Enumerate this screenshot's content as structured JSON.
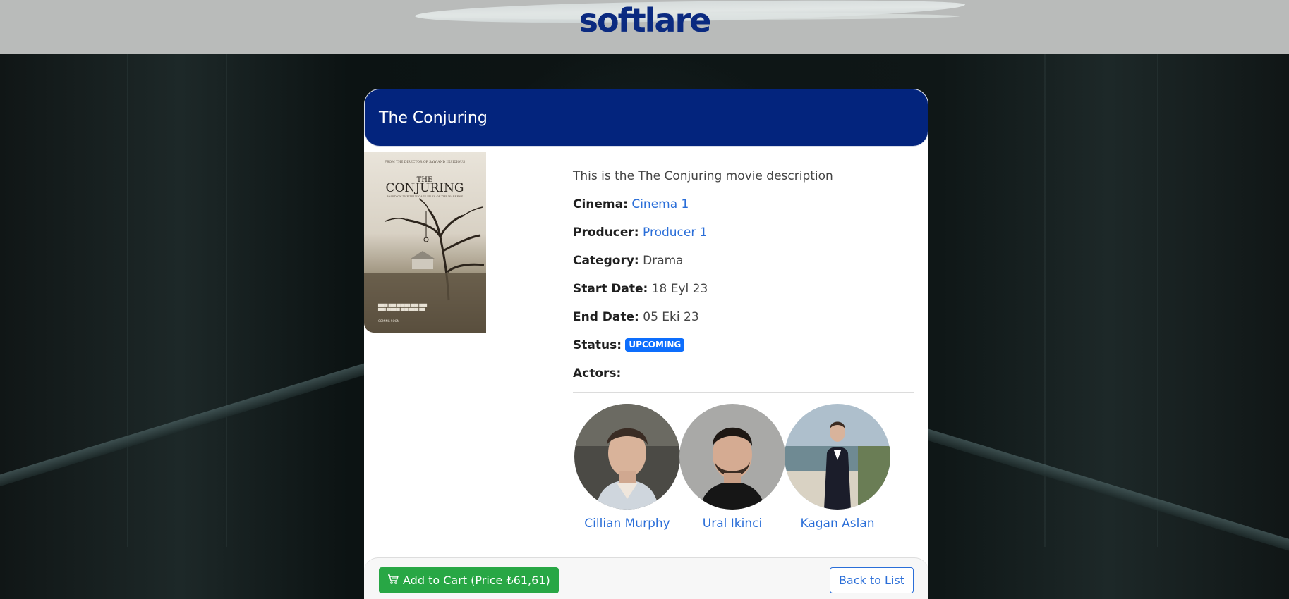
{
  "header": {
    "logo_text": "softlare"
  },
  "movie": {
    "title": "The Conjuring",
    "description": "This is the The Conjuring movie description",
    "cinema_label": "Cinema:",
    "cinema_value": "Cinema 1",
    "producer_label": "Producer:",
    "producer_value": "Producer 1",
    "category_label": "Category:",
    "category_value": "Drama",
    "start_label": "Start Date:",
    "start_value": "18 Eyl 23",
    "end_label": "End Date:",
    "end_value": "05 Eki 23",
    "status_label": "Status:",
    "status_value": "UPCOMING",
    "actors_label": "Actors:",
    "poster": {
      "top_line": "FROM THE DIRECTOR OF SAW AND INSIDIOUS",
      "title_line1": "THE",
      "title_line2": "CONJURING",
      "tagline": "BASED ON THE TRUE CASE FILES OF THE WARRENS",
      "coming_soon": "COMING SOON"
    }
  },
  "actors": [
    {
      "name": "Cillian Murphy"
    },
    {
      "name": "Ural Ikinci"
    },
    {
      "name": "Kagan Aslan"
    }
  ],
  "footer": {
    "cart_icon": "cart-icon",
    "add_to_cart_label": "Add to Cart (Price ₺61,61)",
    "back_label": "Back to List"
  },
  "colors": {
    "brand_navy": "#03247d",
    "link_blue": "#2a6ed8",
    "badge_blue": "#0d6efd",
    "cart_green": "#28a745",
    "topbar_gray": "#b9bbba"
  }
}
